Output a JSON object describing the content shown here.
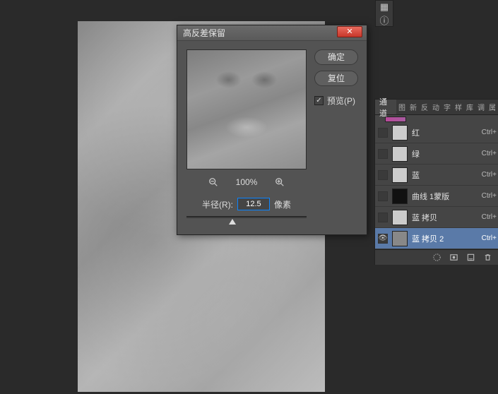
{
  "top_icons": {
    "histogram": "▦",
    "info": "ⓘ"
  },
  "dialog": {
    "title": "高反差保留",
    "ok": "确定",
    "reset": "复位",
    "preview_label": "预览(P)",
    "zoom_level": "100%",
    "radius_label": "半径(R):",
    "radius_value": "12.5",
    "radius_unit": "像素"
  },
  "channels": {
    "tab_main": "通道",
    "tab_others": [
      "图",
      "新",
      "反",
      "动",
      "字",
      "样",
      "库",
      "调",
      "属"
    ],
    "rows": [
      {
        "name": "红",
        "shortcut": "Ctrl+",
        "thumb": "light",
        "visible": false
      },
      {
        "name": "绿",
        "shortcut": "Ctrl+",
        "thumb": "light",
        "visible": false
      },
      {
        "name": "蓝",
        "shortcut": "Ctrl+",
        "thumb": "light",
        "visible": false
      },
      {
        "name": "曲线 1蒙版",
        "shortcut": "Ctrl+",
        "thumb": "dark",
        "visible": false
      },
      {
        "name": "蓝 拷贝",
        "shortcut": "Ctrl+",
        "thumb": "light",
        "visible": false
      },
      {
        "name": "蓝 拷贝 2",
        "shortcut": "Ctrl+",
        "thumb": "mid",
        "visible": true,
        "selected": true
      }
    ]
  }
}
